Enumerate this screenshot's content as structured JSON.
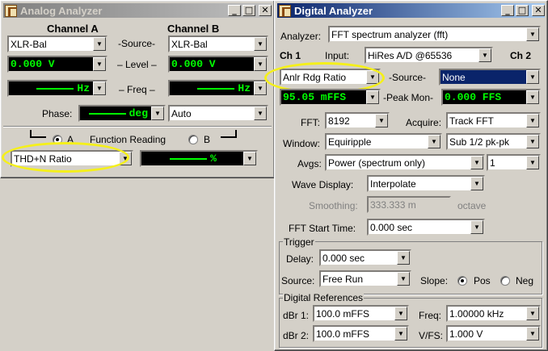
{
  "analog": {
    "title": "Analog Analyzer",
    "channel_a": "Channel A",
    "channel_b": "Channel B",
    "source_label": "-Source-",
    "level_label": "– Level –",
    "freq_label": "– Freq –",
    "phase_label": "Phase:",
    "source_a": "XLR-Bal",
    "source_b": "XLR-Bal",
    "level_a": "0.000   V",
    "level_b": "0.000   V",
    "freq_a_unit": "Hz",
    "freq_b_unit": "Hz",
    "phase_unit": "deg",
    "phase_mode": "Auto",
    "radio_a": "A",
    "radio_b": "B",
    "function_label": "Function Reading",
    "function_value": "THD+N Ratio",
    "function_reading_unit": "%"
  },
  "digital": {
    "title": "Digital Analyzer",
    "analyzer_label": "Analyzer:",
    "analyzer_value": "FFT spectrum analyzer (fft)",
    "ch1_label": "Ch 1",
    "input_label": "Input:",
    "input_value": "HiRes A/D @65536",
    "ch2_label": "Ch 2",
    "source_label": "-Source-",
    "source_ch1": "Anlr Rdg Ratio",
    "source_ch2": "None",
    "peakmon_label": "-Peak Mon-",
    "peakmon_ch1": "95.05   mFFS",
    "peakmon_ch2": "0.000    FFS",
    "fft_label": "FFT:",
    "fft_value": "8192",
    "acquire_label": "Acquire:",
    "acquire_value": "Track FFT",
    "window_label": "Window:",
    "window_value": "Equiripple",
    "window_sub": "Sub 1/2 pk-pk",
    "avgs_label": "Avgs:",
    "avgs_value": "Power (spectrum only)",
    "avgs_count": "1",
    "wave_label": "Wave Display:",
    "wave_value": "Interpolate",
    "smoothing_label": "Smoothing:",
    "smoothing_value": "333.333 m",
    "smoothing_unit": "octave",
    "fft_start_label": "FFT Start Time:",
    "fft_start_value": "0.000    sec",
    "trigger_group": "Trigger",
    "delay_label": "Delay:",
    "delay_value": "0.000    sec",
    "trig_source_label": "Source:",
    "trig_source_value": "Free Run",
    "slope_label": "Slope:",
    "slope_pos": "Pos",
    "slope_neg": "Neg",
    "refs_group": "Digital References",
    "dbr1_label": "dBr 1:",
    "dbr1_value": "100.0   mFFS",
    "dbr2_label": "dBr 2:",
    "dbr2_value": "100.0   mFFS",
    "freq_label": "Freq:",
    "freq_value": "1.00000 kHz",
    "vfs_label": "V/FS:",
    "vfs_value": "1.000    V"
  },
  "colors": {
    "highlight": "#f5f01a",
    "readout_text": "#00ff00",
    "active_title": "#0a246a"
  }
}
